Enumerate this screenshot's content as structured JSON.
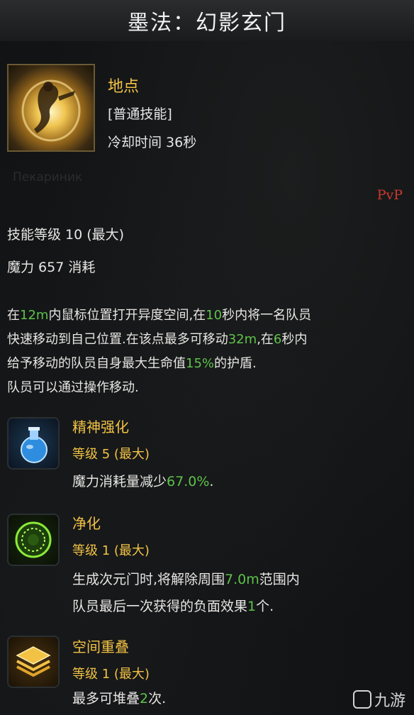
{
  "header": {
    "title": "墨法：幻影玄门"
  },
  "skill": {
    "icon": "phantom-gate-skill-icon",
    "name": "地点",
    "type": "[普通技能]",
    "cooldown": "冷却时间 36秒",
    "ghost_text": "Пекариник",
    "pvp": "PvP",
    "level_line": "技能等级 10 (最大)",
    "mana_line": "魔力 657 消耗"
  },
  "description": {
    "lines": [
      [
        {
          "t": "在"
        },
        {
          "t": "12m",
          "hl": true
        },
        {
          "t": "内鼠标位置打开异度空间,在"
        },
        {
          "t": "10",
          "hl": true
        },
        {
          "t": "秒内将一名队员"
        }
      ],
      [
        {
          "t": "快速移动到自己位置.在该点最多可移动"
        },
        {
          "t": "32m",
          "hl": true
        },
        {
          "t": ",在"
        },
        {
          "t": "6",
          "hl": true
        },
        {
          "t": "秒内"
        }
      ],
      [
        {
          "t": "给予移动的队员自身最大生命值"
        },
        {
          "t": "15%",
          "hl": true
        },
        {
          "t": "的护盾."
        }
      ],
      [
        {
          "t": "队员可以通过操作移动."
        }
      ]
    ]
  },
  "tripods": [
    {
      "icon": "blue-potion-icon",
      "name": "精神强化",
      "level": "等级 5 (最大)",
      "text_lines": [
        [
          {
            "t": "魔力消耗量减少"
          },
          {
            "t": "67.0%",
            "hl": true
          },
          {
            "t": "."
          }
        ]
      ]
    },
    {
      "icon": "green-circle-icon",
      "name": "净化",
      "level": "等级 1 (最大)",
      "text_lines": [
        [
          {
            "t": "生成次元门时,将解除周围"
          },
          {
            "t": "7.0m",
            "hl": true
          },
          {
            "t": "范围内"
          }
        ],
        [
          {
            "t": "队员最后一次获得的负面效果"
          },
          {
            "t": "1",
            "hl": true
          },
          {
            "t": "个."
          }
        ]
      ]
    },
    {
      "icon": "stacked-layers-icon",
      "name": "空间重叠",
      "level": "等级 1 (最大)",
      "text_lines": [
        [
          {
            "t": "最多可堆叠"
          },
          {
            "t": "2",
            "hl": true
          },
          {
            "t": "次."
          }
        ]
      ]
    }
  ],
  "watermark": {
    "text": "九游"
  },
  "colors": {
    "gold": "#f2c244",
    "green": "#5fc24a",
    "pvp_red": "#c8392f"
  }
}
